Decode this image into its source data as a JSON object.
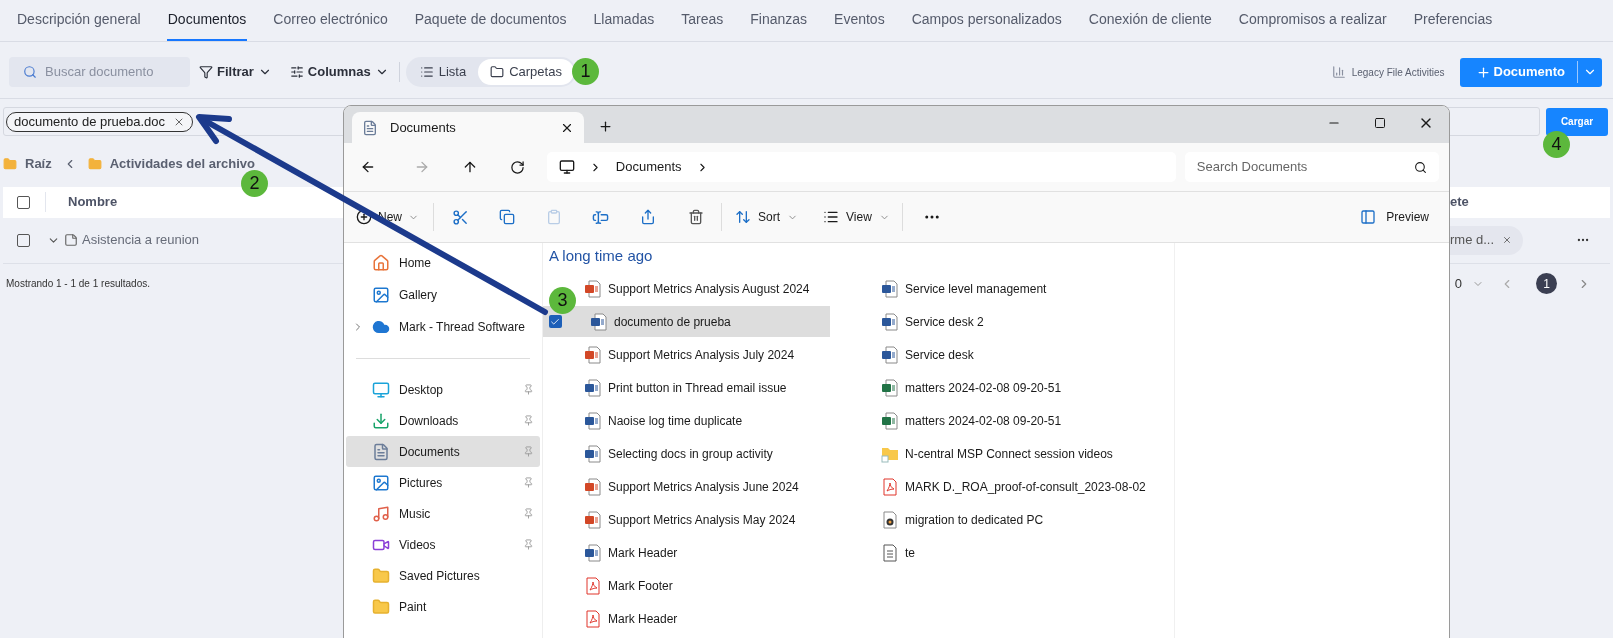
{
  "app_tabs": [
    {
      "label": "Descripción general",
      "selected": false
    },
    {
      "label": "Documentos",
      "selected": true
    },
    {
      "label": "Correo electrónico",
      "selected": false
    },
    {
      "label": "Paquete de documentos",
      "selected": false
    },
    {
      "label": "Llamadas",
      "selected": false
    },
    {
      "label": "Tareas",
      "selected": false
    },
    {
      "label": "Finanzas",
      "selected": false
    },
    {
      "label": "Eventos",
      "selected": false
    },
    {
      "label": "Campos personalizados",
      "selected": false
    },
    {
      "label": "Conexión de cliente",
      "selected": false
    },
    {
      "label": "Compromisos a realizar",
      "selected": false
    },
    {
      "label": "Preferencias",
      "selected": false
    }
  ],
  "toolbar": {
    "search_placeholder": "Buscar documento",
    "filter": "Filtrar",
    "columns": "Columnas",
    "views": [
      {
        "label": "Lista",
        "selected": false
      },
      {
        "label": "Carpetas",
        "selected": true
      }
    ],
    "legacy_link": "Legacy File Activities",
    "new_button": "Documento"
  },
  "upload": {
    "chip": "documento de prueba.doc",
    "button": "Cargar"
  },
  "breadcrumb": [
    "Raíz",
    "Actividades del archivo"
  ],
  "table": {
    "header_checked": false,
    "columns": [
      "Nombre",
      "ete"
    ],
    "rows": [
      {
        "checked": false,
        "name": "Asistencia a reunion",
        "column_2": "rme d..."
      }
    ]
  },
  "footer": {
    "summary": "Mostrando 1 - 1 de 1 resultados.",
    "page_size": "0",
    "pages": [
      {
        "label": "1",
        "selected": true
      }
    ]
  },
  "explorer": {
    "tab": "Documents",
    "address": "Documents",
    "search_placeholder": "Search Documents",
    "commands": {
      "new": "New",
      "sort": "Sort",
      "view": "View",
      "preview": "Preview"
    },
    "nav_top": [
      {
        "label": "Home",
        "kind": "home",
        "expandable": false
      },
      {
        "label": "Gallery",
        "kind": "gallery",
        "expandable": false
      },
      {
        "label": "Mark - Thread Software",
        "kind": "cloud",
        "expandable": true
      }
    ],
    "nav_places": [
      {
        "label": "Desktop",
        "kind": "desktop",
        "pinned": true,
        "selected": false
      },
      {
        "label": "Downloads",
        "kind": "downloads",
        "pinned": true,
        "selected": false
      },
      {
        "label": "Documents",
        "kind": "documents",
        "pinned": true,
        "selected": true
      },
      {
        "label": "Pictures",
        "kind": "pictures",
        "pinned": true,
        "selected": false
      },
      {
        "label": "Music",
        "kind": "music",
        "pinned": true,
        "selected": false
      },
      {
        "label": "Videos",
        "kind": "videos",
        "pinned": true,
        "selected": false
      },
      {
        "label": "Saved Pictures",
        "kind": "folder",
        "pinned": false,
        "selected": false
      },
      {
        "label": "Paint",
        "kind": "folder",
        "pinned": false,
        "selected": false
      }
    ],
    "group": "A long time ago",
    "files": [
      {
        "name": "Support Metrics Analysis August 2024",
        "kind": "ppt",
        "selected": false
      },
      {
        "name": "documento de prueba",
        "kind": "word",
        "selected": true
      },
      {
        "name": "Support Metrics Analysis July 2024",
        "kind": "ppt",
        "selected": false
      },
      {
        "name": "Print button in Thread email issue",
        "kind": "word",
        "selected": false
      },
      {
        "name": "Naoise log time duplicate",
        "kind": "word",
        "selected": false
      },
      {
        "name": "Selecting docs in group activity",
        "kind": "word",
        "selected": false
      },
      {
        "name": "Support Metrics Analysis June 2024",
        "kind": "ppt",
        "selected": false
      },
      {
        "name": "Support Metrics Analysis May 2024",
        "kind": "ppt",
        "selected": false
      },
      {
        "name": "Mark Header",
        "kind": "word",
        "selected": false
      },
      {
        "name": "Mark Footer",
        "kind": "pdf",
        "selected": false
      },
      {
        "name": "Mark Header",
        "kind": "pdf",
        "selected": false
      },
      {
        "name": "Service level management",
        "kind": "word",
        "selected": false
      },
      {
        "name": "Service desk 2",
        "kind": "word",
        "selected": false
      },
      {
        "name": "Service desk",
        "kind": "word",
        "selected": false
      },
      {
        "name": "matters 2024-02-08 09-20-51",
        "kind": "excel",
        "selected": false
      },
      {
        "name": "matters 2024-02-08 09-20-51",
        "kind": "excel",
        "selected": false
      },
      {
        "name": "N-central MSP Connect session videos",
        "kind": "folder",
        "selected": false
      },
      {
        "name": "MARK D._ROA_proof-of-consult_2023-08-02",
        "kind": "pdf",
        "selected": false
      },
      {
        "name": "migration to dedicated PC",
        "kind": "media",
        "selected": false
      },
      {
        "name": "te",
        "kind": "text",
        "selected": false
      }
    ]
  },
  "annotations": [
    "1",
    "2",
    "3",
    "4"
  ]
}
